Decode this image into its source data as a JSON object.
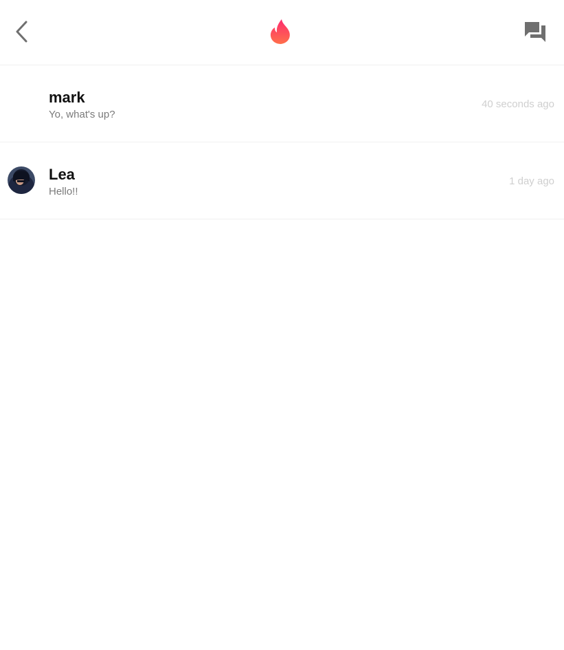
{
  "header": {
    "back_icon": "chevron-left-icon",
    "logo_icon": "flame-logo-icon",
    "chat_icon": "chat-bubbles-icon",
    "icon_color": "#6f6f6f",
    "logo_gradient": [
      "#ff3d6f",
      "#ff7a4d"
    ]
  },
  "conversations": [
    {
      "name": "mark",
      "message": "Yo, what's up?",
      "time": "40 seconds ago",
      "has_avatar": false
    },
    {
      "name": "Lea",
      "message": "Hello!!",
      "time": "1 day ago",
      "has_avatar": true
    }
  ]
}
